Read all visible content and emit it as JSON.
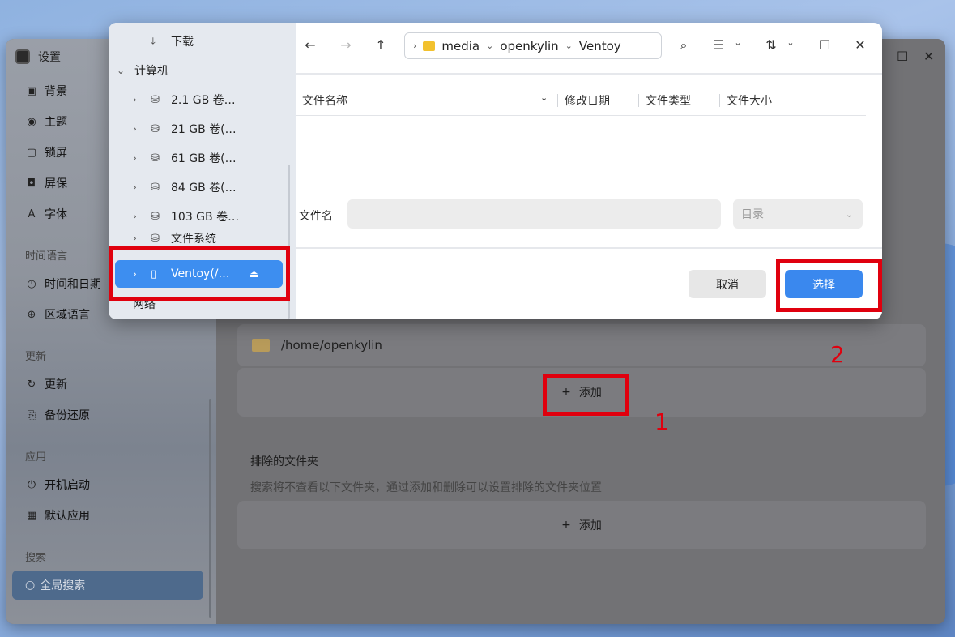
{
  "settings": {
    "app_title": "设置",
    "sidebar": {
      "items_top": [
        {
          "label": "背景",
          "icon": "image-icon"
        },
        {
          "label": "主题",
          "icon": "palette-icon"
        },
        {
          "label": "锁屏",
          "icon": "lock-screen-icon"
        },
        {
          "label": "屏保",
          "icon": "screensaver-icon"
        },
        {
          "label": "字体",
          "icon": "font-icon"
        }
      ],
      "section_time": "时间语言",
      "items_time": [
        {
          "label": "时间和日期",
          "icon": "clock-icon"
        },
        {
          "label": "区域语言",
          "icon": "globe-icon"
        }
      ],
      "section_update": "更新",
      "items_update": [
        {
          "label": "更新",
          "icon": "refresh-icon"
        },
        {
          "label": "备份还原",
          "icon": "backup-icon"
        }
      ],
      "section_apps": "应用",
      "items_apps": [
        {
          "label": "开机启动",
          "icon": "startup-icon"
        },
        {
          "label": "默认应用",
          "icon": "grid-icon"
        }
      ],
      "section_search": "搜索",
      "global_search": "全局搜索"
    },
    "main": {
      "search_folder_path": "/home/openkylin",
      "add_label": "添加",
      "excluded_title": "排除的文件夹",
      "excluded_desc": "搜索将不查看以下文件夹，通过添加和删除可以设置排除的文件夹位置",
      "excluded_add_label": "添加"
    }
  },
  "dialog": {
    "sidebar": [
      {
        "label": "下载",
        "icon": "download-icon",
        "indent": 2
      },
      {
        "label": "计算机",
        "icon": "",
        "chevron": "expanded"
      },
      {
        "label": "2.1 GB 卷…",
        "icon": "drive-icon",
        "chevron": "collapsed"
      },
      {
        "label": "21 GB 卷(…",
        "icon": "drive-icon",
        "chevron": "collapsed"
      },
      {
        "label": "61 GB 卷(…",
        "icon": "drive-icon",
        "chevron": "collapsed"
      },
      {
        "label": "84 GB 卷(…",
        "icon": "drive-icon",
        "chevron": "collapsed"
      },
      {
        "label": "103 GB 卷…",
        "icon": "drive-icon",
        "chevron": "collapsed"
      },
      {
        "label": "文件系统",
        "icon": "drive-icon",
        "chevron": "collapsed"
      }
    ],
    "selected_item": "Ventoy(/…",
    "network_label": "网络",
    "breadcrumb": [
      "media",
      "openkylin",
      "Ventoy"
    ],
    "columns": [
      "文件名称",
      "修改日期",
      "文件类型",
      "文件大小"
    ],
    "filename_label": "文件名",
    "filename_value": "",
    "filter_placeholder": "目录",
    "cancel_label": "取消",
    "select_label": "选择"
  },
  "annotations": {
    "step1": "1",
    "step2": "2",
    "color": "#e0000e"
  }
}
